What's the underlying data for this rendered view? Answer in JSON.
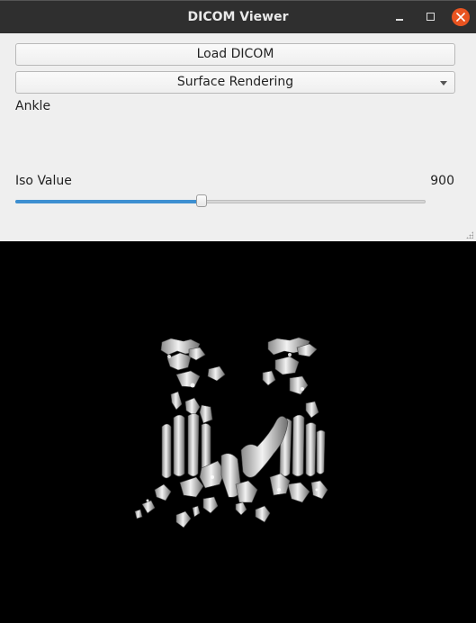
{
  "window": {
    "title": "DICOM Viewer"
  },
  "controls": {
    "load_button_label": "Load DICOM",
    "render_mode": {
      "selected": "Surface Rendering"
    },
    "dataset_label": "Ankle",
    "iso": {
      "label": "Iso Value",
      "value": "900",
      "slider_fraction": 0.455
    }
  },
  "colors": {
    "titlebar": "#2f2f2f",
    "close_button": "#e95420",
    "slider_accent": "#3d8fd1",
    "viewport_background": "#000000",
    "bone_surface": "#d9d9d9"
  }
}
